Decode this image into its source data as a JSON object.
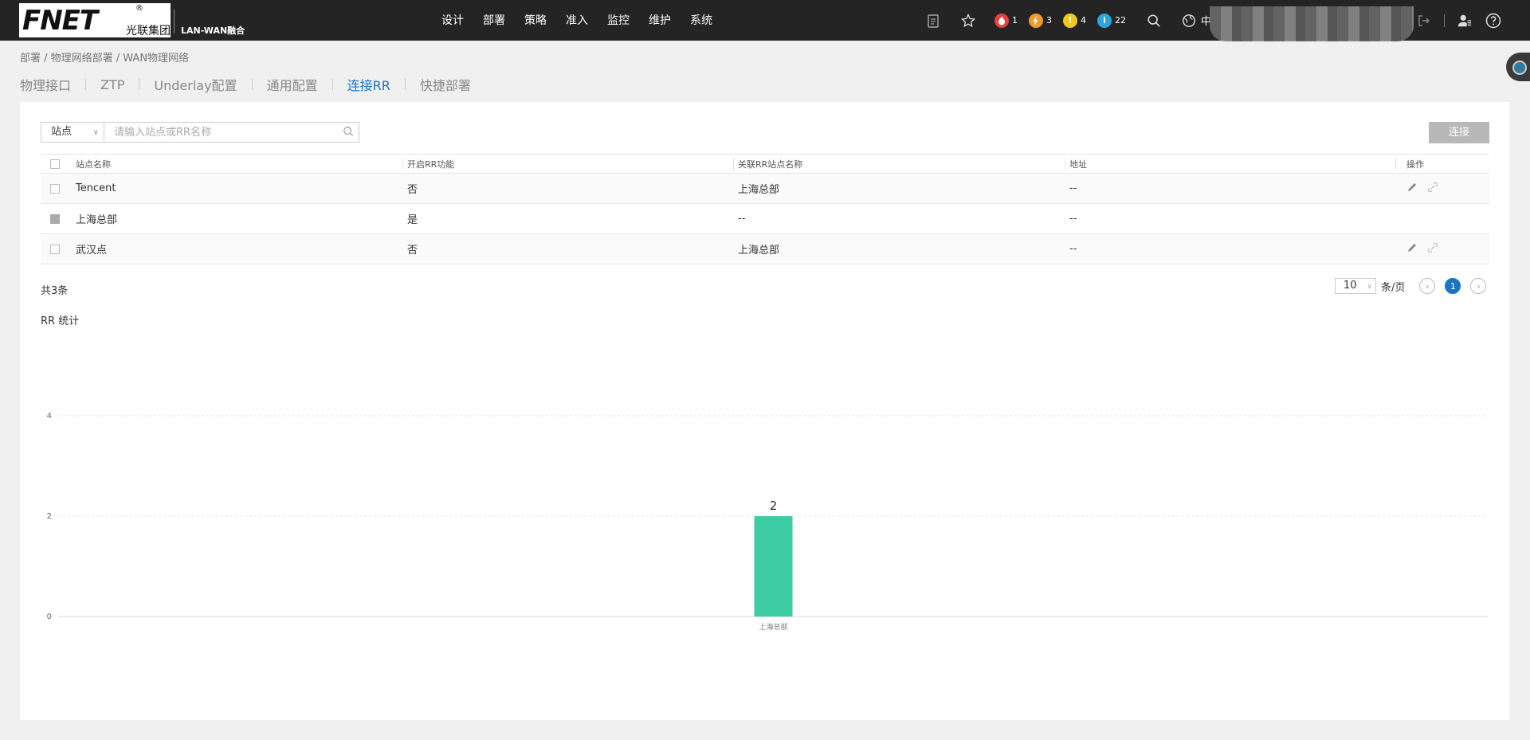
{
  "header": {
    "logo": {
      "text": "FNET",
      "registered": "®",
      "subtitle": "光联集团"
    },
    "product": "LAN-WAN融合",
    "nav": [
      "设计",
      "部署",
      "策略",
      "准入",
      "监控",
      "维护",
      "系统"
    ],
    "alarms": [
      {
        "icon": "fire-icon",
        "count": "1",
        "color": "#e8413c"
      },
      {
        "icon": "lightning-icon",
        "count": "3",
        "color": "#f29a2e"
      },
      {
        "icon": "exclamation-icon",
        "count": "4",
        "color": "#f2c91a"
      },
      {
        "icon": "info-icon",
        "count": "22",
        "color": "#2aa5e0"
      }
    ],
    "language": "中"
  },
  "breadcrumb": "部署 / 物理网络部署 / WAN物理网络",
  "tabs": [
    "物理接口",
    "ZTP",
    "Underlay配置",
    "通用配置",
    "连接RR",
    "快捷部署"
  ],
  "active_tab": 4,
  "filter": {
    "select_value": "站点",
    "search_placeholder": "请输入站点或RR名称"
  },
  "connect_button": "连接",
  "table": {
    "columns": [
      "站点名称",
      "开启RR功能",
      "关联RR站点名称",
      "地址",
      "操作"
    ],
    "rows": [
      {
        "name": "Tencent",
        "rr_enabled": "否",
        "rr_site": "上海总部",
        "address": "--",
        "has_actions": true,
        "checkbox_disabled": false
      },
      {
        "name": "上海总部",
        "rr_enabled": "是",
        "rr_site": "--",
        "address": "--",
        "has_actions": false,
        "checkbox_disabled": true
      },
      {
        "name": "武汉点",
        "rr_enabled": "否",
        "rr_site": "上海总部",
        "address": "--",
        "has_actions": true,
        "checkbox_disabled": false
      }
    ]
  },
  "pagination": {
    "total": "共3条",
    "page_size": "10",
    "per_page_label": "条/页",
    "current_page": "1"
  },
  "stats_title": "RR 统计",
  "chart_data": {
    "type": "bar",
    "categories": [
      "上海总部"
    ],
    "values": [
      2
    ],
    "ylim": [
      0,
      4
    ],
    "yticks": [
      0,
      2,
      4
    ],
    "grid": true,
    "bar_color": "#3ecca5",
    "data_labels": true
  }
}
